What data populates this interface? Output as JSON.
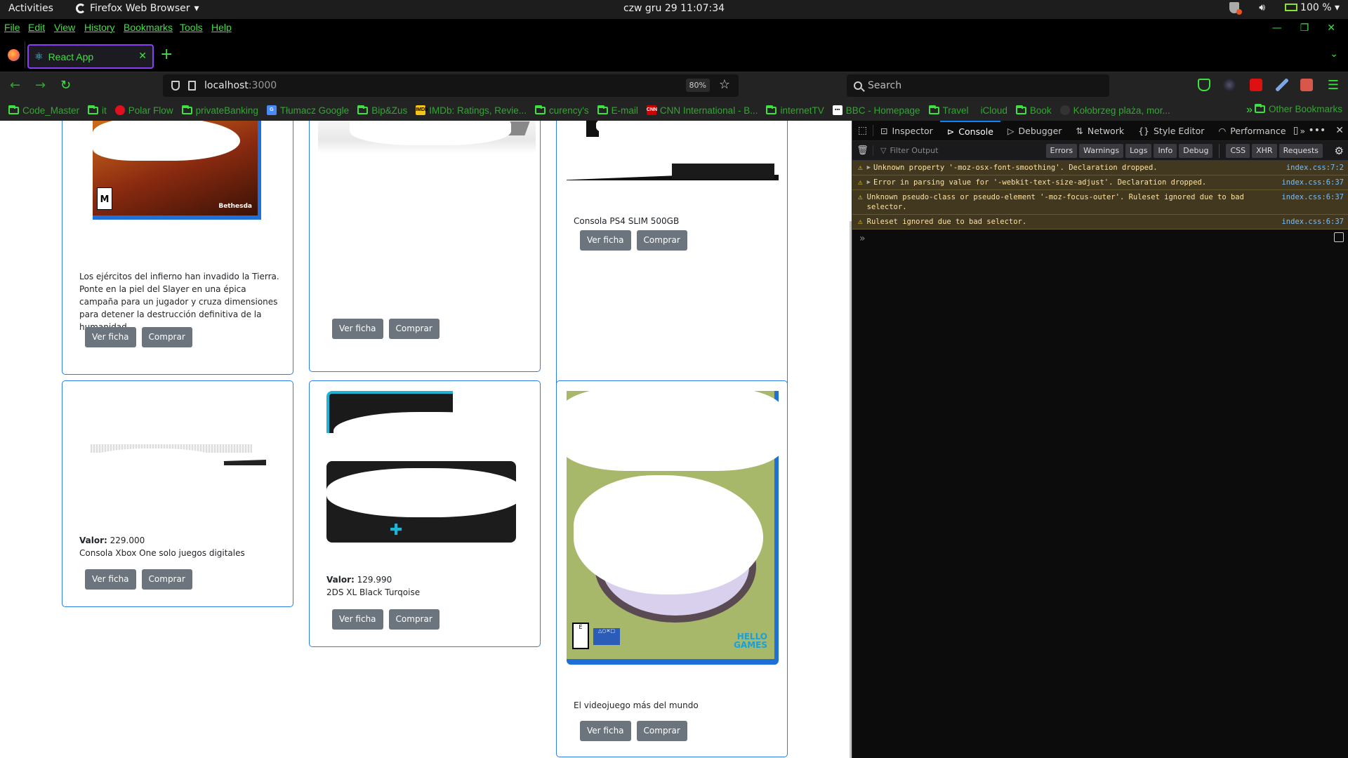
{
  "system": {
    "activities": "Activities",
    "app_name": "Firefox Web Browser",
    "clock": "czw gru 29  11:07:34",
    "battery": "100 %"
  },
  "menubar": {
    "items": [
      "File",
      "Edit",
      "View",
      "History",
      "Bookmarks",
      "Tools",
      "Help"
    ]
  },
  "tabs": [
    {
      "title": "React App",
      "icon": "react-icon",
      "active": true
    }
  ],
  "navbar": {
    "url_host": "localhost",
    "url_port": ":3000",
    "zoom": "80%",
    "search_placeholder": "Search"
  },
  "bookmarks": [
    {
      "label": "Code_Master",
      "icon": "folder-icon"
    },
    {
      "label": "it",
      "icon": "folder-icon"
    },
    {
      "label": "Polar Flow",
      "icon": "polar-icon"
    },
    {
      "label": "privateBanking",
      "icon": "folder-icon"
    },
    {
      "label": "Tłumacz Google",
      "icon": "google-translate-icon"
    },
    {
      "label": "Bip&Zus",
      "icon": "folder-icon"
    },
    {
      "label": "IMDb: Ratings, Revie...",
      "icon": "imdb-icon"
    },
    {
      "label": "curency's",
      "icon": "folder-icon"
    },
    {
      "label": "E-mail",
      "icon": "folder-icon"
    },
    {
      "label": "CNN International - B...",
      "icon": "cnn-icon"
    },
    {
      "label": "internetTV",
      "icon": "folder-icon"
    },
    {
      "label": "BBC - Homepage",
      "icon": "bbc-icon"
    },
    {
      "label": "Travel",
      "icon": "folder-icon"
    },
    {
      "label": "iCloud",
      "icon": "apple-icon"
    },
    {
      "label": "Book",
      "icon": "folder-icon"
    },
    {
      "label": "Kołobrzeg plaża, mor...",
      "icon": "map-icon"
    }
  ],
  "other_bookmarks": "Other Bookmarks",
  "products": [
    {
      "id": "doom",
      "value_label": "",
      "value": "",
      "description": "Los ejércitos del infierno han invadido la Tierra. Ponte en la piel del Slayer en una épica campaña para un jugador y cruza dimensiones para detener la destrucción definitiva de la humanidad.",
      "btn_view": "Ver ficha",
      "btn_buy": "Comprar"
    },
    {
      "id": "switch",
      "value_label": "",
      "value": "",
      "description": "",
      "btn_view": "Ver ficha",
      "btn_buy": "Comprar"
    },
    {
      "id": "ps4",
      "value_label": "",
      "value": "",
      "description": "Consola PS4 SLIM 500GB",
      "btn_view": "Ver ficha",
      "btn_buy": "Comprar"
    },
    {
      "id": "xbox",
      "value_label": "Valor:",
      "value": "229.000",
      "description": "Consola Xbox One solo juegos digitales",
      "btn_view": "Ver ficha",
      "btn_buy": "Comprar"
    },
    {
      "id": "2ds",
      "value_label": "Valor:",
      "value": "129.990",
      "description": "2DS XL Black Turqoise",
      "btn_view": "Ver ficha",
      "btn_buy": "Comprar"
    },
    {
      "id": "nms",
      "value_label": "",
      "value": "",
      "description": "El videojuego más del mundo",
      "btn_view": "Ver ficha",
      "btn_buy": "Comprar"
    }
  ],
  "devtools": {
    "tabs": [
      "Inspector",
      "Console",
      "Debugger",
      "Network",
      "Style Editor",
      "Performance"
    ],
    "active_tab": "Console",
    "filter_placeholder": "Filter Output",
    "level_filters": [
      "Errors",
      "Warnings",
      "Logs",
      "Info",
      "Debug"
    ],
    "type_filters": [
      "CSS",
      "XHR",
      "Requests"
    ],
    "messages": [
      {
        "level": "warning",
        "expandable": true,
        "text": "Unknown property '-moz-osx-font-smoothing'.  Declaration dropped.",
        "source": "index.css:7:2"
      },
      {
        "level": "warning",
        "expandable": true,
        "text": "Error in parsing value for '-webkit-text-size-adjust'.  Declaration dropped.",
        "source": "index.css:6:37"
      },
      {
        "level": "warning",
        "expandable": false,
        "text": "Unknown pseudo-class or pseudo-element '-moz-focus-outer'.  Ruleset ignored due to bad selector.",
        "source": "index.css:6:37"
      },
      {
        "level": "warning",
        "expandable": false,
        "text": "Ruleset ignored due to bad selector.",
        "source": "index.css:6:37"
      }
    ],
    "prompt": "»"
  }
}
